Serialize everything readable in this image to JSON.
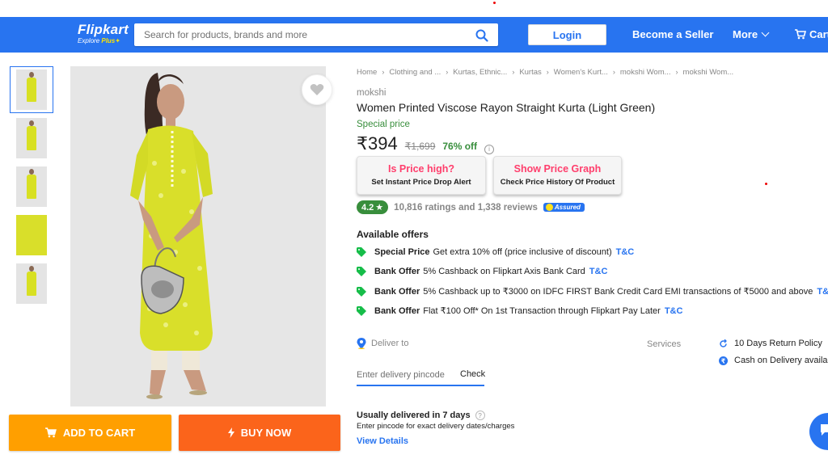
{
  "header": {
    "logo": "Flipkart",
    "tagline": "Explore",
    "tagline_plus": "Plus",
    "search_placeholder": "Search for products, brands and more",
    "login_label": "Login",
    "seller_label": "Become a Seller",
    "more_label": "More",
    "cart_label": "Cart"
  },
  "gallery": {
    "thumbnail_count": 5,
    "active_index": 0
  },
  "actions": {
    "add_to_cart": "ADD TO CART",
    "buy_now": "BUY NOW"
  },
  "breadcrumb": [
    "Home",
    "Clothing and ...",
    "Kurtas, Ethnic...",
    "Kurtas",
    "Women's Kurt...",
    "mokshi Wom...",
    "mokshi Wom..."
  ],
  "product": {
    "brand": "mokshi",
    "title": "Women Printed Viscose Rayon Straight Kurta  (Light Green)",
    "special_price_label": "Special price",
    "price": "₹394",
    "mrp": "₹1,699",
    "discount": "76% off",
    "rating": "4.2",
    "rating_text": "10,816 ratings and 1,338 reviews",
    "assured_label": "Assured"
  },
  "price_tools": {
    "alert_title": "Is Price high?",
    "alert_sub": "Set Instant Price Drop Alert",
    "graph_title": "Show Price Graph",
    "graph_sub": "Check Price History Of Product"
  },
  "offers": {
    "heading": "Available offers",
    "items": [
      {
        "type": "Special Price",
        "text": "Get extra 10% off (price inclusive of discount)",
        "link": "T&C"
      },
      {
        "type": "Bank Offer",
        "text": "5% Cashback on Flipkart Axis Bank Card",
        "link": "T&C"
      },
      {
        "type": "Bank Offer",
        "text": "5% Cashback up to ₹3000 on IDFC FIRST Bank Credit Card EMI transactions of ₹5000 and above",
        "link": "T&C"
      },
      {
        "type": "Bank Offer",
        "text": "Flat ₹100 Off* On 1st Transaction through Flipkart Pay Later",
        "link": "T&C"
      }
    ]
  },
  "delivery": {
    "deliver_to": "Deliver to",
    "pincode_placeholder": "Enter delivery pincode",
    "check_label": "Check",
    "usually": "Usually delivered in 7 days",
    "usually_sub": "Enter pincode for exact delivery dates/charges",
    "view_details": "View Details"
  },
  "services": {
    "label": "Services",
    "items": [
      "10 Days Return Policy",
      "Cash on Delivery available"
    ]
  },
  "colors": {
    "brand_blue": "#2874f0",
    "cart_orange": "#ff9f00",
    "buy_orange": "#fb641b",
    "green": "#388e3c",
    "alert_pink": "#ff3e6c",
    "kurta_yellow": "#d9df2a"
  }
}
